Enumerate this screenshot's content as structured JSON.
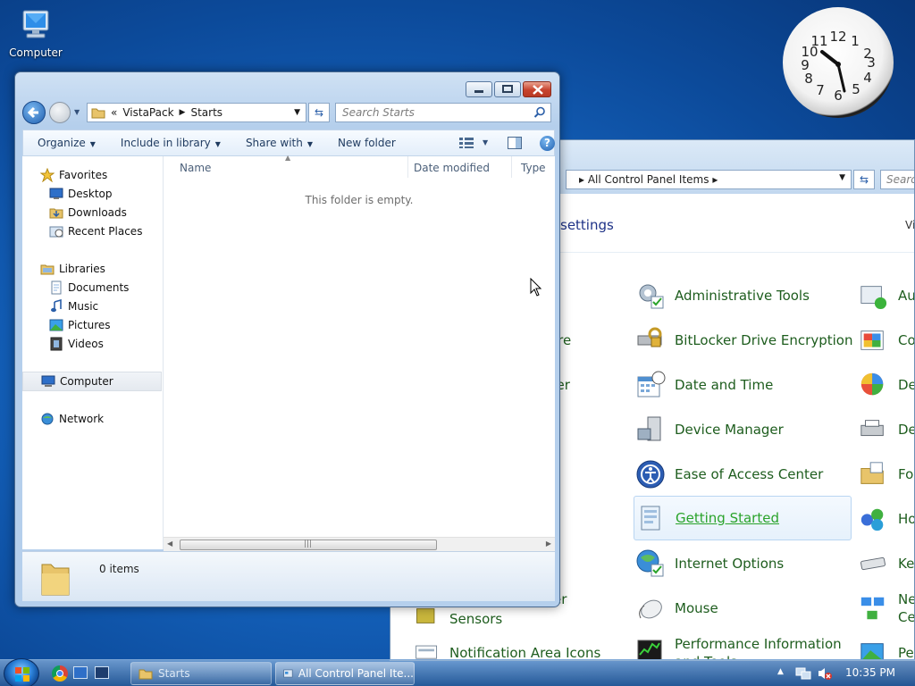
{
  "desktop": {
    "computer_label": "Computer"
  },
  "clock": {
    "time": "10:35",
    "numbers": [
      "12",
      "1",
      "2",
      "3",
      "4",
      "5",
      "6",
      "7",
      "8",
      "9",
      "10",
      "11"
    ]
  },
  "explorer": {
    "breadcrumb": {
      "chevron": "«",
      "parts": [
        "VistaPack",
        "Starts"
      ]
    },
    "search_placeholder": "Search Starts",
    "toolbar": {
      "organize": "Organize",
      "include": "Include in library",
      "share": "Share with",
      "new_folder": "New folder"
    },
    "nav": {
      "favorites": "Favorites",
      "desktop": "Desktop",
      "downloads": "Downloads",
      "recent": "Recent Places",
      "libraries": "Libraries",
      "documents": "Documents",
      "music": "Music",
      "pictures": "Pictures",
      "videos": "Videos",
      "computer": "Computer",
      "network": "Network"
    },
    "columns": {
      "name": "Name",
      "date": "Date modified",
      "type": "Type"
    },
    "empty_text": "This folder is empty.",
    "item_count": "0 items"
  },
  "control_panel": {
    "breadcrumb": "All Control Panel Items",
    "search_placeholder": "Searc",
    "title": "settings",
    "view_by": "Vi",
    "items_col1": {
      "admin_tools": "Administrative Tools",
      "bitlocker": "BitLocker Drive Encryption",
      "date_time": "Date and Time",
      "device_manager": "Device Manager",
      "ease_access": "Ease of Access Center",
      "getting_started": "Getting Started",
      "internet_options": "Internet Options",
      "mouse": "Mouse",
      "performance": "Performance Information",
      "performance_2": "and Tools"
    },
    "items_col0": {
      "ore": "ore",
      "ger": "ger",
      "er": "er",
      "sensors": "Sensors",
      "notification": "Notification Area Icons"
    },
    "items_col2": {
      "au": "Au",
      "co": "Co",
      "de1": "De",
      "de2": "De",
      "fo": "Fo",
      "ho": "Ho",
      "ke": "Ke",
      "ne": "Ne",
      "ce": "Ce",
      "pe": "Pe"
    }
  },
  "taskbar": {
    "task_starts": "Starts",
    "task_cp": "All Control Panel Ite...",
    "time": "10:35 PM"
  }
}
